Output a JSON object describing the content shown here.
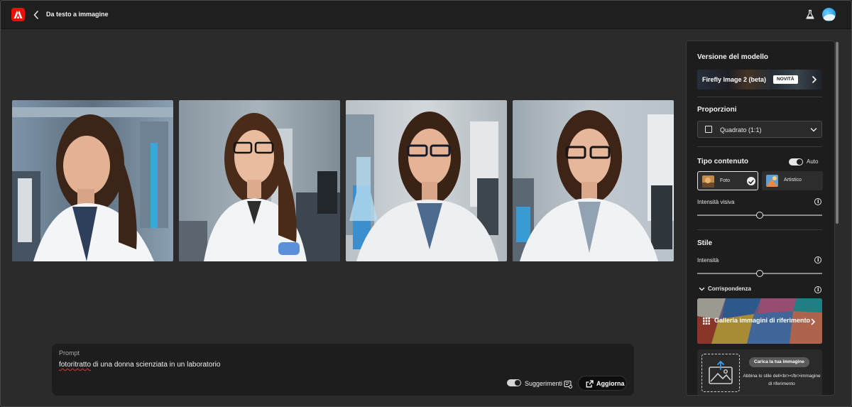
{
  "header": {
    "title": "Da testo a immagine"
  },
  "gallery": {
    "images": [
      {
        "name": "result-image-1"
      },
      {
        "name": "result-image-2"
      },
      {
        "name": "result-image-3"
      },
      {
        "name": "result-image-4"
      }
    ]
  },
  "prompt": {
    "label": "Prompt",
    "text_spelled": "fotoritratto",
    "text_rest": " di una donna scienziata in un laboratorio",
    "suggestions_label": "Suggerimenti",
    "suggestions_on": true,
    "update_label": "Aggiorna"
  },
  "panel": {
    "model": {
      "title": "Versione del modello",
      "name": "Firefly Image 2 (beta)",
      "badge": "NOVITÀ"
    },
    "ratio": {
      "title": "Proporzioni",
      "value": "Quadrato (1:1)"
    },
    "content_type": {
      "title": "Tipo contenuto",
      "auto_label": "Auto",
      "auto_on": true,
      "options": [
        {
          "label": "Foto",
          "selected": true
        },
        {
          "label": "Artistico",
          "selected": false
        }
      ],
      "visual_intensity_label": "Intensità visiva",
      "visual_intensity_value": 0.5
    },
    "style": {
      "title": "Stile",
      "intensity_label": "Intensità",
      "intensity_value": 0.5,
      "match_label": "Corrispondenza",
      "gallery_label": "Galleria immagini di riferimento",
      "upload_button": "Carica la tua immagine",
      "upload_text": "Abbina lo stile dell<br></br>immagine di riferimento"
    }
  },
  "colors": {
    "accent": "#eb1000",
    "background": "#2b2b2b",
    "panel": "#1d1d1d"
  }
}
